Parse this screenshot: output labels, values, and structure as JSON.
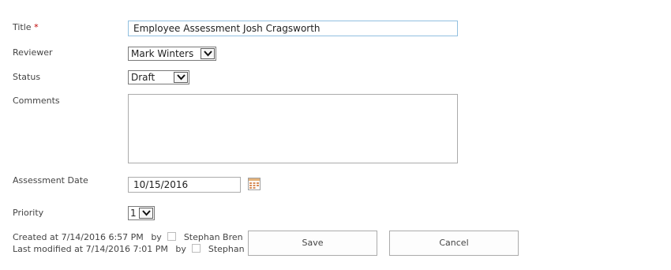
{
  "form": {
    "title": {
      "label": "Title",
      "required_mark": "*",
      "value": "Employee Assessment Josh Cragsworth"
    },
    "reviewer": {
      "label": "Reviewer",
      "selected": "Mark Winters"
    },
    "status": {
      "label": "Status",
      "selected": "Draft"
    },
    "comments": {
      "label": "Comments",
      "value": ""
    },
    "assessment_date": {
      "label": "Assessment Date",
      "value": "10/15/2016"
    },
    "priority": {
      "label": "Priority",
      "selected": "1"
    }
  },
  "meta": {
    "created_text": "Created at 7/14/2016 6:57 PM",
    "created_by_label": "by",
    "created_by_user": "Stephan Bren",
    "modified_text": "Last modified at 7/14/2016 7:01 PM",
    "modified_by_label": "by",
    "modified_by_user": "Stephan Bren"
  },
  "buttons": {
    "save": "Save",
    "cancel": "Cancel"
  },
  "icons": {
    "calendar": "calendar-icon",
    "dropdown": "chevron-down-icon"
  },
  "colors": {
    "focus_border": "#92c0e0",
    "required": "#bf0000"
  }
}
